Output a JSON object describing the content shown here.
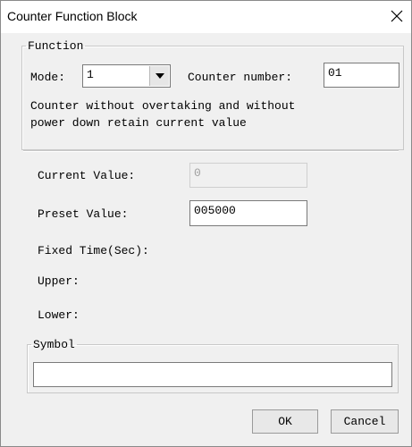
{
  "window": {
    "title": "Counter Function Block",
    "close_symbol": "✕"
  },
  "function_group": {
    "legend": "Function",
    "mode_label": "Mode:",
    "mode_value": "1",
    "counter_number_label": "Counter number:",
    "counter_number_value": "01",
    "description_line1": "Counter without overtaking and without",
    "description_line2": "power down retain current value"
  },
  "values": {
    "current_label": "Current Value:",
    "current_value": "0",
    "preset_label": "Preset Value:",
    "preset_value": "005000",
    "fixed_time_label": "Fixed Time(Sec):",
    "upper_label": "Upper:",
    "lower_label": "Lower:"
  },
  "symbol_group": {
    "legend": "Symbol",
    "value": ""
  },
  "buttons": {
    "ok": "OK",
    "cancel": "Cancel"
  }
}
